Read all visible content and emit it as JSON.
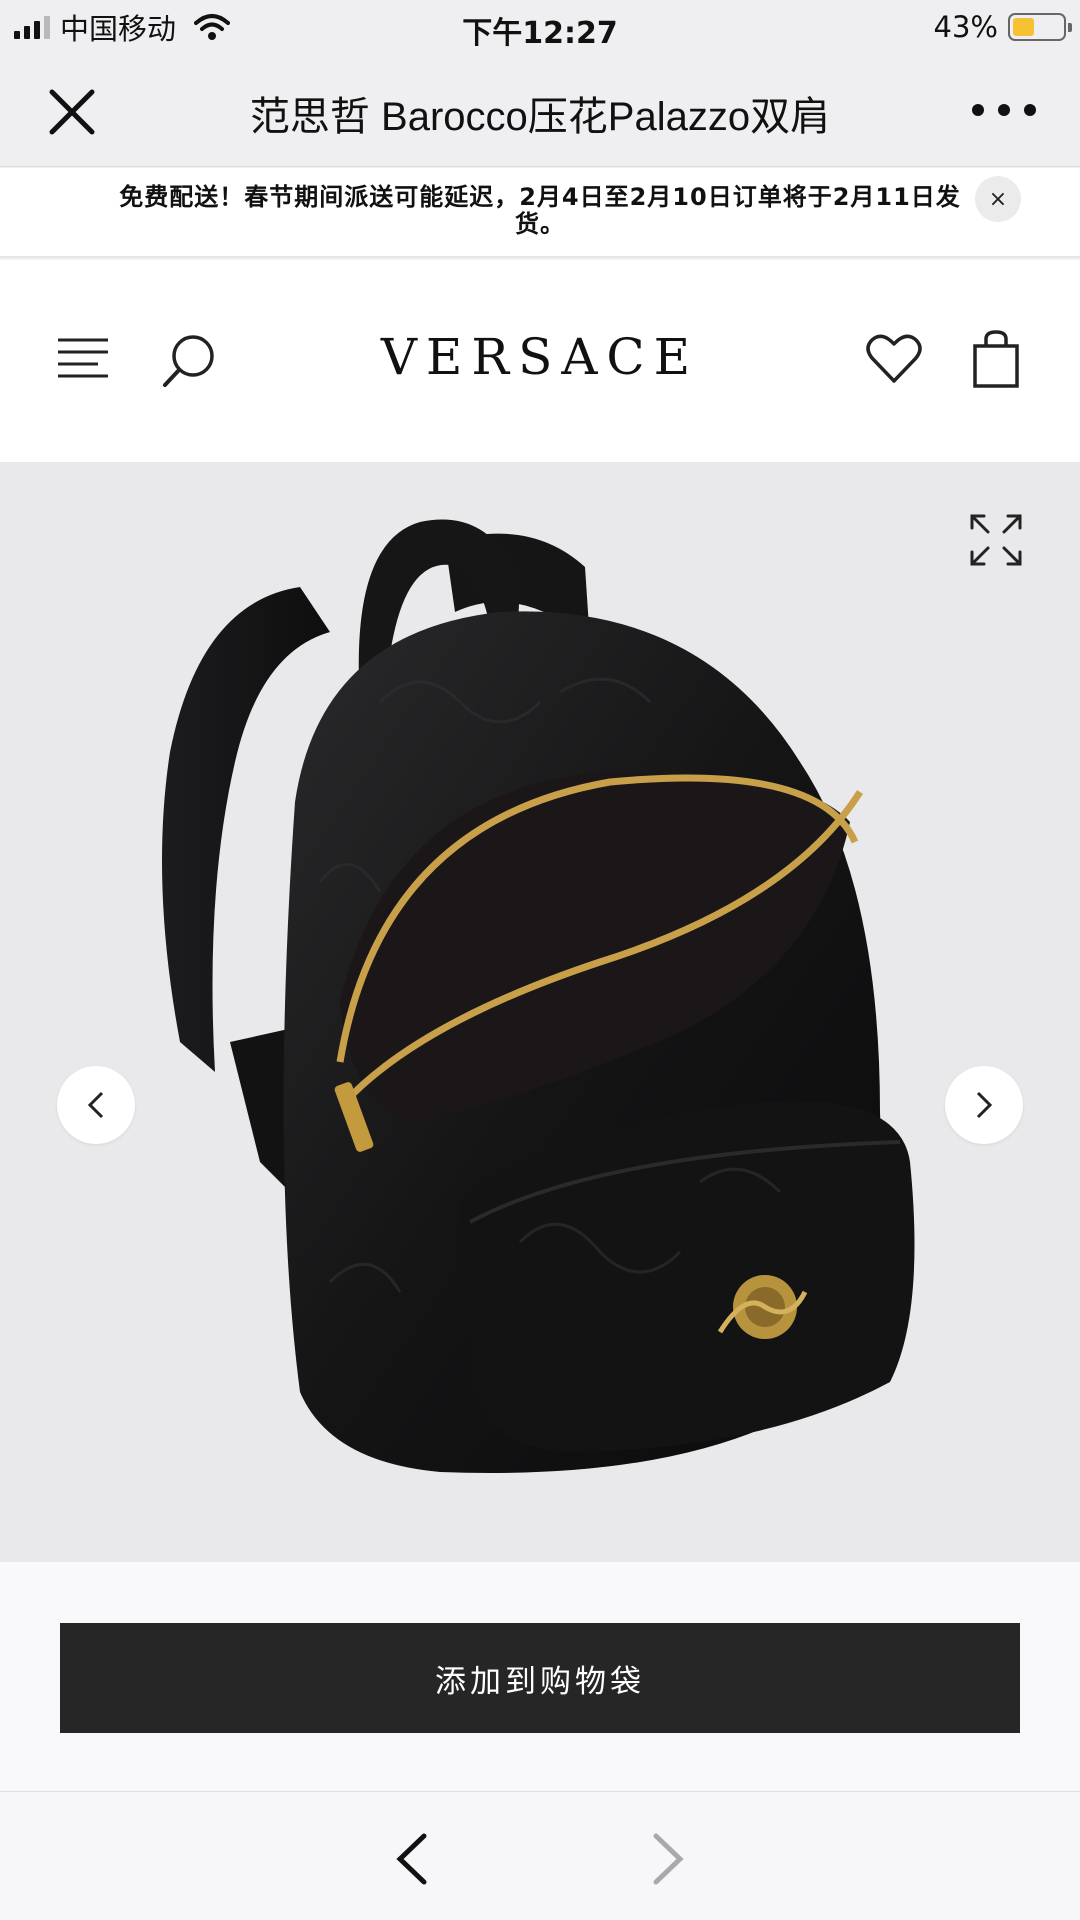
{
  "status_bar": {
    "carrier": "中国移动",
    "time": "下午12:27",
    "battery_percent": "43%",
    "battery_level": 0.43,
    "battery_color": "#f6c233"
  },
  "title_bar": {
    "title": "范思哲 Barocco压花Palazzo双肩",
    "close_icon": "close-icon",
    "more_icon": "more-horizontal-icon"
  },
  "promo_banner": {
    "text": "免费配送！春节期间派送可能延迟，2月4日至2月10日订单将于2月11日发货。",
    "close_label": "×"
  },
  "site_header": {
    "logo": "VERSACE",
    "menu_icon": "menu-icon",
    "search_icon": "search-icon",
    "wishlist_icon": "heart-icon",
    "bag_icon": "shopping-bag-icon"
  },
  "gallery": {
    "expand_icon": "expand-icon",
    "prev_icon": "chevron-left-icon",
    "next_icon": "chevron-right-icon",
    "image_subject": "black embossed leather backpack"
  },
  "cta": {
    "add_to_bag_label": "添加到购物袋",
    "button_color": "#262626"
  },
  "browser_nav": {
    "back_icon": "back-arrow-icon",
    "forward_icon": "forward-arrow-icon"
  }
}
